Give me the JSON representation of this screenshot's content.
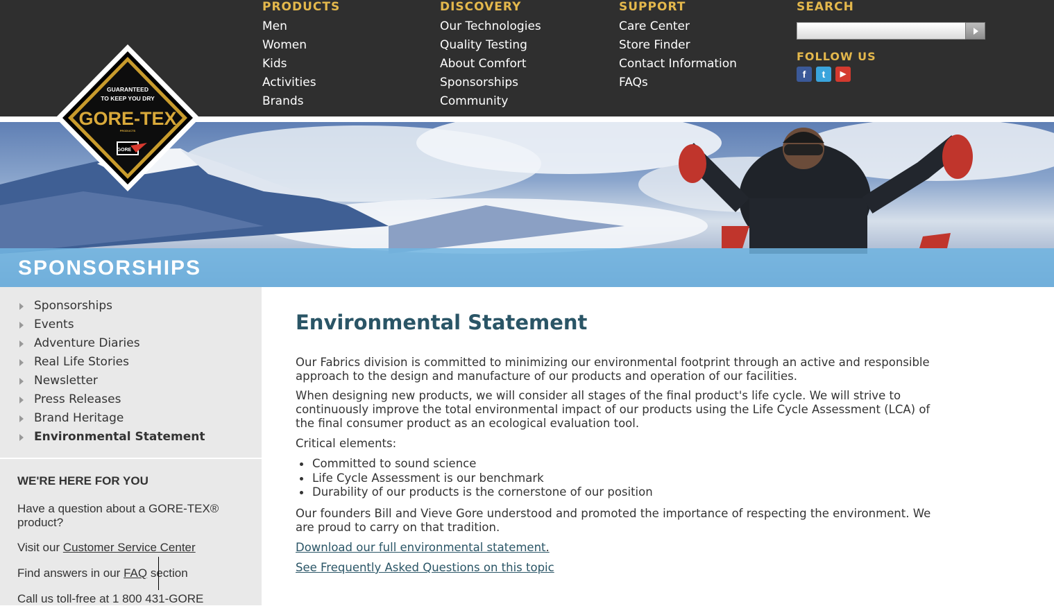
{
  "nav": {
    "columns": [
      {
        "heading": "PRODUCTS",
        "links": [
          "Men",
          "Women",
          "Kids",
          "Activities",
          "Brands"
        ]
      },
      {
        "heading": "DISCOVERY",
        "links": [
          "Our Technologies",
          "Quality Testing",
          "About Comfort",
          "Sponsorships",
          "Community"
        ]
      },
      {
        "heading": "SUPPORT",
        "links": [
          "Care Center",
          "Store Finder",
          "Contact Information",
          "FAQs"
        ]
      }
    ],
    "search_heading": "SEARCH",
    "search_value": "",
    "follow_heading": "FOLLOW US",
    "social": [
      {
        "icon": "facebook-icon",
        "glyph": "f",
        "color": "#3b5998"
      },
      {
        "icon": "twitter-icon",
        "glyph": "t",
        "color": "#3aa4dc"
      },
      {
        "icon": "youtube-icon",
        "glyph": "▶",
        "color": "#d43a2f"
      }
    ]
  },
  "logo": {
    "line1": "GUARANTEED",
    "line2": "TO KEEP YOU DRY",
    "brand": "GORE-TEX",
    "sub": "PRODUCTS",
    "badge": "GORE"
  },
  "hero": {
    "title": "SPONSORSHIPS"
  },
  "sidebar": {
    "items": [
      {
        "label": "Sponsorships",
        "active": false
      },
      {
        "label": "Events",
        "active": false
      },
      {
        "label": "Adventure Diaries",
        "active": false
      },
      {
        "label": "Real Life Stories",
        "active": false
      },
      {
        "label": "Newsletter",
        "active": false
      },
      {
        "label": "Press Releases",
        "active": false
      },
      {
        "label": "Brand Heritage",
        "active": false
      },
      {
        "label": "Environmental Statement",
        "active": true
      }
    ],
    "help_heading": "WE'RE HERE FOR YOU",
    "help_question": "Have a question about a GORE-TEX® product?",
    "visit_prefix": "Visit our ",
    "visit_link": "Customer Service Center",
    "faq_prefix": "Find answers in our ",
    "faq_link": "FAQ",
    "faq_suffix": " section",
    "call_text": "Call us toll-free at 1 800 431-GORE"
  },
  "main": {
    "title": "Environmental Statement",
    "para1": "Our Fabrics division is committed to minimizing our environmental footprint through an active and responsible approach to the design and manufacture of our products and operation of our facilities.",
    "para2": "When designing new products, we will consider all stages of the final product's life cycle. We will strive to continuously improve the total environmental impact of our products using the Life Cycle Assessment (LCA) of the final consumer product as an ecological evaluation tool.",
    "critical_label": "Critical elements:",
    "bullets": [
      "Committed to sound science",
      "Life Cycle Assessment is our benchmark",
      "Durability of our products is the cornerstone of our position"
    ],
    "para3": "Our founders Bill and Vieve Gore understood and promoted the importance of respecting the environment. We are proud to carry on that tradition.",
    "download_link": "Download our full environmental statement",
    "download_suffix": ".",
    "faq_link": "See Frequently Asked Questions on this topic"
  }
}
